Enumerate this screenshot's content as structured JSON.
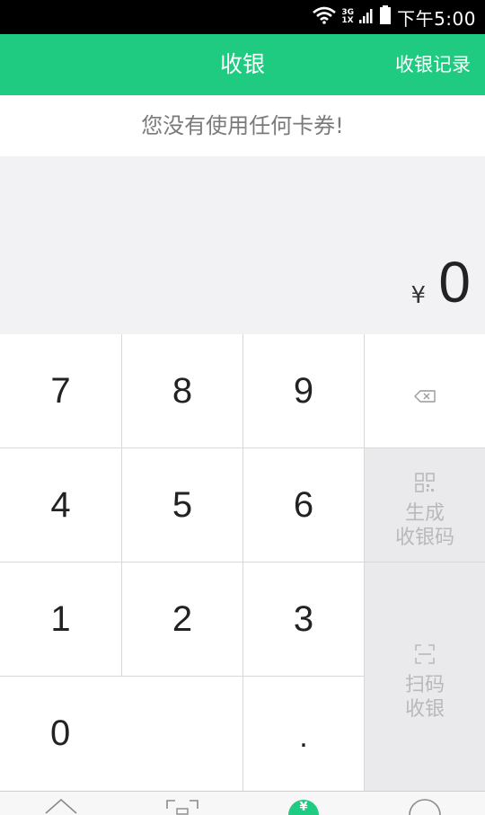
{
  "status_bar": {
    "network_top": "3G",
    "network_bottom": "1X",
    "time": "下午5:00"
  },
  "header": {
    "title": "收银",
    "action_label": "收银记录"
  },
  "coupon_notice": "您没有使用任何卡券!",
  "amount": {
    "currency_symbol": "¥",
    "value": "0"
  },
  "keypad": {
    "keys": [
      "7",
      "8",
      "9",
      "4",
      "5",
      "6",
      "1",
      "2",
      "3",
      "0",
      "."
    ],
    "generate_code_label": [
      "生成",
      "收银码"
    ],
    "scan_label": [
      "扫码",
      "收银"
    ]
  },
  "bottom_nav": {
    "active_glyph": "¥"
  },
  "colors": {
    "accent": "#1ecb80",
    "status_bar": "#000000",
    "action_key_bg": "#eaeaec",
    "action_key_text": "#b9b9bd"
  },
  "icons": [
    "wifi-icon",
    "signal-icon",
    "battery-icon",
    "backspace-icon",
    "qr-code-icon",
    "scan-frame-icon",
    "home-icon",
    "scan-nav-icon",
    "cashier-nav-icon",
    "profile-icon"
  ]
}
